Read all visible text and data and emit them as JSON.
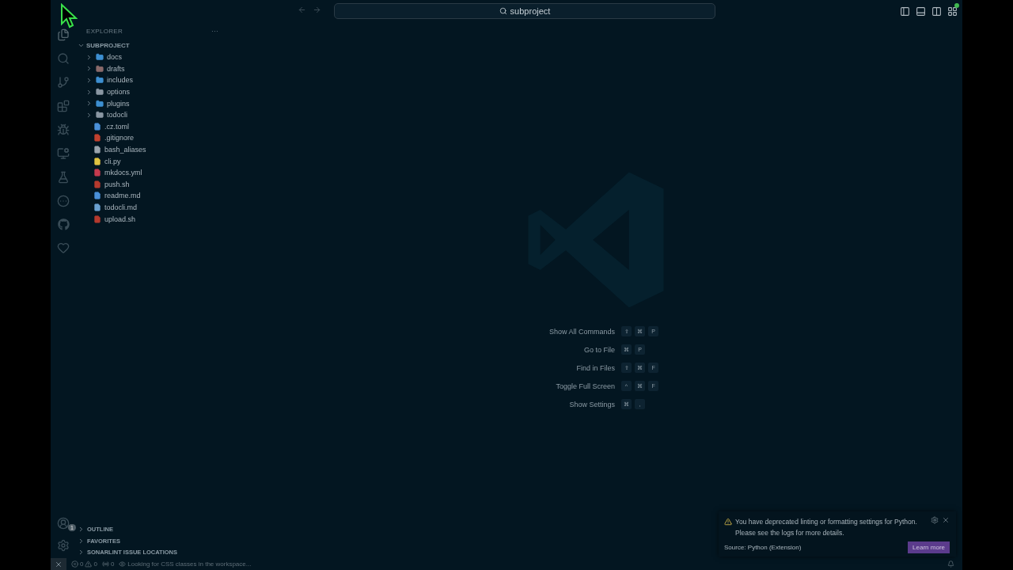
{
  "titlebar": {
    "search": "subproject"
  },
  "explorer": {
    "title": "EXPLORER",
    "more": "···",
    "root": {
      "label": "SUBPROJECT",
      "expanded": true,
      "children": [
        {
          "kind": "folder",
          "label": "docs",
          "expanded": false,
          "color": "#3d8fd1"
        },
        {
          "kind": "folder",
          "label": "drafts",
          "expanded": false,
          "color": "#8a6a6a"
        },
        {
          "kind": "folder",
          "label": "includes",
          "expanded": false,
          "color": "#3d8fd1"
        },
        {
          "kind": "folder",
          "label": "options",
          "expanded": false,
          "color": "#8a97a3"
        },
        {
          "kind": "folder",
          "label": "plugins",
          "expanded": false,
          "color": "#3d8fd1"
        },
        {
          "kind": "folder",
          "label": "todocli",
          "expanded": false,
          "color": "#8a97a3"
        },
        {
          "kind": "file",
          "label": ".cz.toml",
          "color": "#4a90d9"
        },
        {
          "kind": "file",
          "label": ".gitignore",
          "color": "#c0412f"
        },
        {
          "kind": "file",
          "label": "bash_aliases",
          "color": "#9aa4ad"
        },
        {
          "kind": "file",
          "label": "cli.py",
          "color": "#e0c341"
        },
        {
          "kind": "file",
          "label": "mkdocs.yml",
          "color": "#c43a4e"
        },
        {
          "kind": "file",
          "label": "push.sh",
          "color": "#b53a2e"
        },
        {
          "kind": "file",
          "label": "readme.md",
          "color": "#4a90d9"
        },
        {
          "kind": "file",
          "label": "todocli.md",
          "color": "#6aa0d0"
        },
        {
          "kind": "file",
          "label": "upload.sh",
          "color": "#b53a2e"
        }
      ]
    },
    "sections": [
      {
        "label": "OUTLINE",
        "expanded": false
      },
      {
        "label": "FAVORITES",
        "expanded": false
      },
      {
        "label": "SONARLINT ISSUE LOCATIONS",
        "expanded": false
      }
    ]
  },
  "accounts_badge": "1",
  "shortcuts": [
    {
      "label": "Show All Commands",
      "keys": [
        "⇧",
        "⌘",
        "P"
      ]
    },
    {
      "label": "Go to File",
      "keys": [
        "⌘",
        "P"
      ]
    },
    {
      "label": "Find in Files",
      "keys": [
        "⇧",
        "⌘",
        "F"
      ]
    },
    {
      "label": "Toggle Full Screen",
      "keys": [
        "^",
        "⌘",
        "F"
      ]
    },
    {
      "label": "Show Settings",
      "keys": [
        "⌘",
        ","
      ]
    }
  ],
  "notification": {
    "message": "You have deprecated linting or formatting settings for Python. Please see the logs for more details.",
    "source": "Source: Python (Extension)",
    "action": "Learn more"
  },
  "status_bar": {
    "errors": "0",
    "warnings": "0",
    "ports": "0",
    "message": "Looking for CSS classes in the workspace..."
  }
}
